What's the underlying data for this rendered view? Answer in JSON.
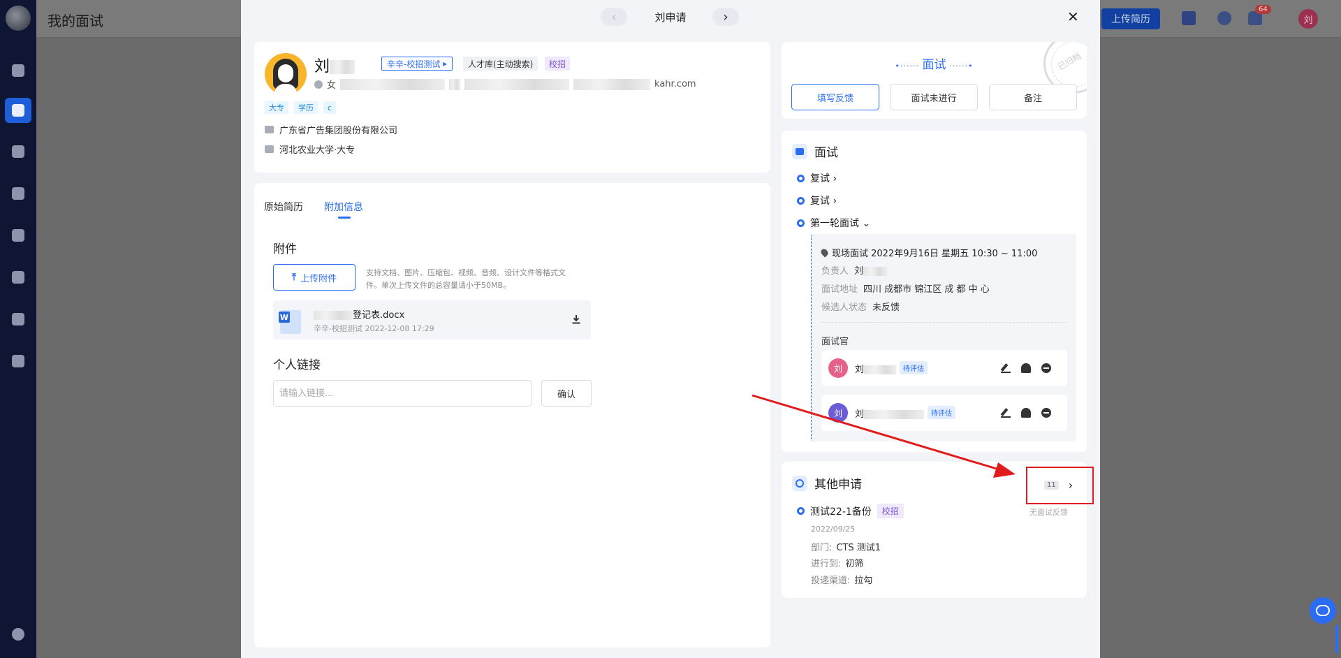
{
  "app": {
    "page_title": "我的面试",
    "upload_resume": "上传简历",
    "notification_count": "64",
    "user_avatar": "刘"
  },
  "drawer": {
    "title": "刘申请",
    "prev": "‹",
    "next": "›",
    "close": "✕"
  },
  "candidate": {
    "name": "刘",
    "channel_tag": "辛辛-校招测试",
    "pool_tag": "人才库(主动搜索)",
    "type_tag": "校招",
    "gender": "女",
    "email_suffix": "kahr.com",
    "chips": [
      "大专",
      "学历",
      "c"
    ],
    "company": "广东省广告集团股份有限公司",
    "school": "河北农业大学·大专"
  },
  "tabs": [
    "原始简历",
    "附加信息"
  ],
  "attachments": {
    "title": "附件",
    "upload_label": "上传附件",
    "hint": "支持文档、图片、压缩包、视频、音频、设计文件等格式文件。单次上传文件的总容量请小于50MB。",
    "file": {
      "name": "登记表.docx",
      "meta": "辛辛-校招测试 2022-12-08 17:29",
      "icon": "W"
    },
    "links_title": "个人链接",
    "link_placeholder": "请输入链接...",
    "confirm": "确认"
  },
  "status": {
    "title": "面试",
    "stamp": "已归档",
    "actions": [
      "填写反馈",
      "面试未进行",
      "备注"
    ]
  },
  "interview": {
    "title": "面试",
    "rounds": [
      "复试 ›",
      "复试 ›",
      "第一轮面试 ⌄"
    ],
    "detail": {
      "line1": "现场面试 2022年9月16日 星期五 10:30 ~ 11:00",
      "owner_key": "负责人",
      "owner_val": "刘",
      "address_key": "面试地址",
      "address_val": "四川 成都市 锦江区 成 都 中 心",
      "status_key": "候选人状态",
      "status_val": "未反馈",
      "interviewers_title": "面试官",
      "interviewers": [
        {
          "avatar": "刘",
          "name": "刘",
          "status": "待评估",
          "color": "#e6628a"
        },
        {
          "avatar": "刘",
          "name": "刘",
          "status": "待评估",
          "color": "#6a5bd8"
        }
      ]
    }
  },
  "other": {
    "title": "其他申请",
    "count": "11",
    "chev": "›",
    "app_name": "测试22-1备份",
    "app_tag": "校招",
    "no_feedback": "无面试反馈",
    "date": "2022/09/25",
    "dept_key": "部门:",
    "dept_val": "CTS 测试1",
    "stage_key": "进行到:",
    "stage_val": "初筛",
    "channel_key": "投递渠道:",
    "channel_val": "拉勾"
  },
  "colors": {
    "accent": "#2a6df4",
    "annotation": "#e21c1c",
    "sidebar": "#0e1633"
  }
}
